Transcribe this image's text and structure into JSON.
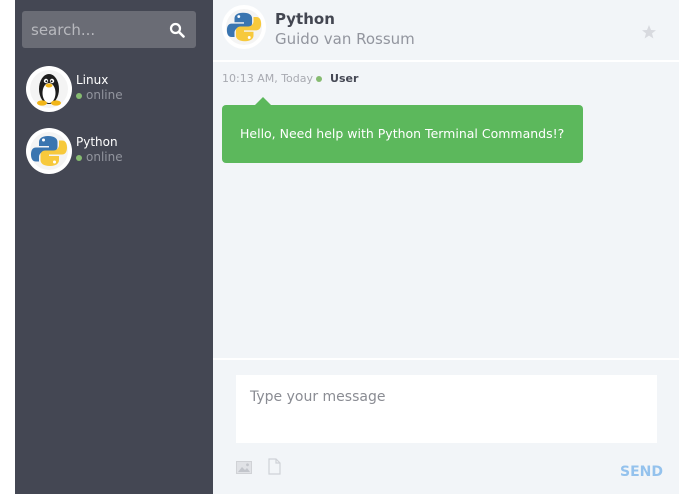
{
  "search": {
    "placeholder": "search..."
  },
  "contacts": [
    {
      "name": "Linux",
      "status": "online",
      "icon": "linux-tux-icon"
    },
    {
      "name": "Python",
      "status": "online",
      "icon": "python-logo-icon"
    }
  ],
  "chat": {
    "title": "Python",
    "subtitle": "Guido van Rossum",
    "header_icon": "python-logo-icon"
  },
  "messages": [
    {
      "time": "10:13 AM, Today",
      "author": "User",
      "text": "Hello, Need help with Python Terminal Commands!?"
    }
  ],
  "composer": {
    "placeholder": "Type your message",
    "send_label": "SEND"
  },
  "colors": {
    "sidebar": "#444753",
    "chat_bg": "#f2f5f8",
    "bubble": "#5cb85c",
    "online": "#86bb71",
    "send": "#94c2ed"
  }
}
